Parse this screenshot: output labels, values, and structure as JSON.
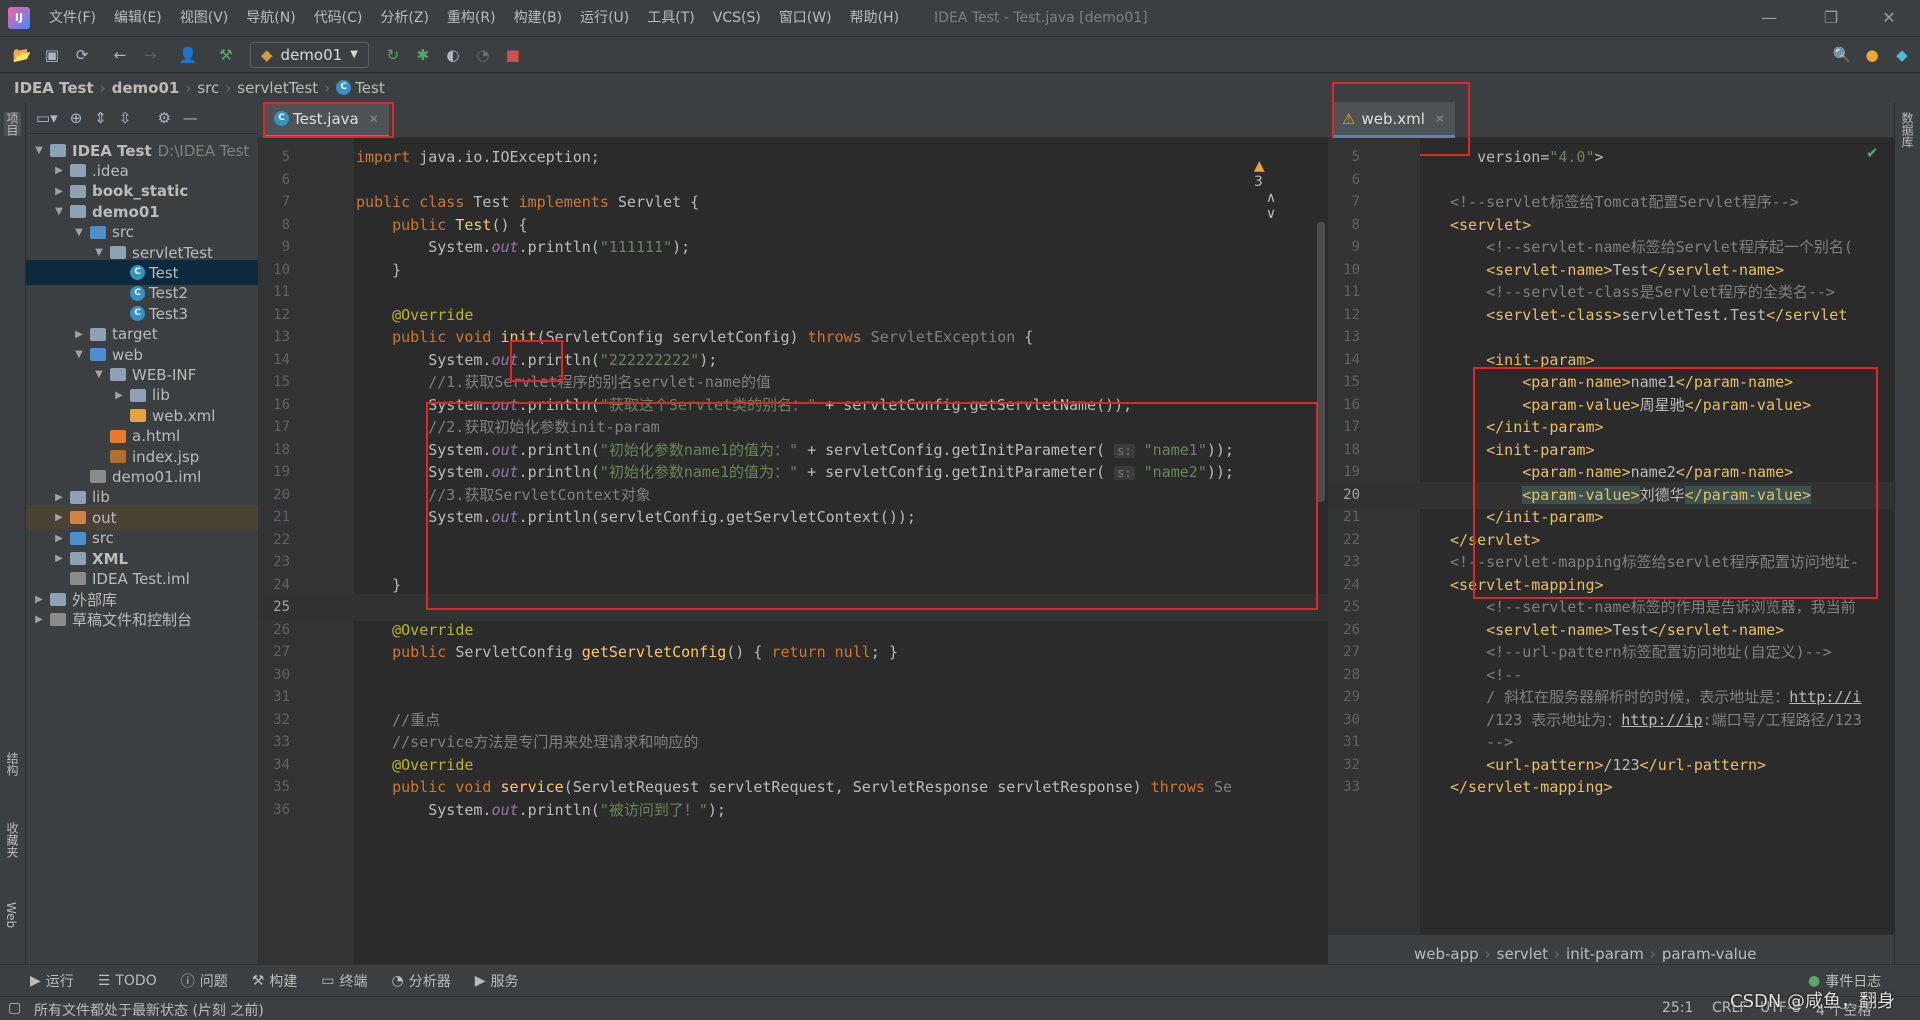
{
  "menubar": {
    "items": [
      "文件(F)",
      "编辑(E)",
      "视图(V)",
      "导航(N)",
      "代码(C)",
      "分析(Z)",
      "重构(R)",
      "构建(B)",
      "运行(U)",
      "工具(T)",
      "VCS(S)",
      "窗口(W)",
      "帮助(H)"
    ],
    "title": "IDEA Test - Test.java [demo01]"
  },
  "toolbar": {
    "run_config": "demo01"
  },
  "breadcrumb": [
    "IDEA Test",
    "demo01",
    "src",
    "servletTest",
    "Test"
  ],
  "side": {
    "left_top": "项目",
    "left_structure": "结构",
    "left_fav": "收藏夹",
    "left_web": "Web",
    "right_db": "数据库"
  },
  "tree": [
    {
      "label": "IDEA Test",
      "extra": "D:\\IDEA Test",
      "depth": 0,
      "arrow": "▼",
      "icon": "folder",
      "bold": true
    },
    {
      "label": ".idea",
      "depth": 1,
      "arrow": "▶",
      "icon": "folder"
    },
    {
      "label": "book_static",
      "depth": 1,
      "arrow": "▶",
      "icon": "folder",
      "bold": true
    },
    {
      "label": "demo01",
      "depth": 1,
      "arrow": "▼",
      "icon": "folder",
      "bold": true
    },
    {
      "label": "src",
      "depth": 2,
      "arrow": "▼",
      "icon": "folder src"
    },
    {
      "label": "servletTest",
      "depth": 3,
      "arrow": "▼",
      "icon": "folder"
    },
    {
      "label": "Test",
      "depth": 4,
      "arrow": "",
      "icon": "class",
      "selected": true
    },
    {
      "label": "Test2",
      "depth": 4,
      "arrow": "",
      "icon": "class"
    },
    {
      "label": "Test3",
      "depth": 4,
      "arrow": "",
      "icon": "class"
    },
    {
      "label": "target",
      "depth": 2,
      "arrow": "▶",
      "icon": "folder"
    },
    {
      "label": "web",
      "depth": 2,
      "arrow": "▼",
      "icon": "folder web"
    },
    {
      "label": "WEB-INF",
      "depth": 3,
      "arrow": "▼",
      "icon": "folder"
    },
    {
      "label": "lib",
      "depth": 4,
      "arrow": "▶",
      "icon": "folder"
    },
    {
      "label": "web.xml",
      "depth": 4,
      "arrow": "",
      "icon": "file-xml"
    },
    {
      "label": "a.html",
      "depth": 3,
      "arrow": "",
      "icon": "file-html"
    },
    {
      "label": "index.jsp",
      "depth": 3,
      "arrow": "",
      "icon": "file-jsp"
    },
    {
      "label": "demo01.iml",
      "depth": 2,
      "arrow": "",
      "icon": "file-iml"
    },
    {
      "label": "lib",
      "depth": 1,
      "arrow": "▶",
      "icon": "folder"
    },
    {
      "label": "out",
      "depth": 1,
      "arrow": "▶",
      "icon": "folder out",
      "out": true
    },
    {
      "label": "src",
      "depth": 1,
      "arrow": "▶",
      "icon": "folder src"
    },
    {
      "label": "XML",
      "depth": 1,
      "arrow": "▶",
      "icon": "folder",
      "bold": true
    },
    {
      "label": "IDEA Test.iml",
      "depth": 1,
      "arrow": "",
      "icon": "file-iml"
    },
    {
      "label": "外部库",
      "depth": 0,
      "arrow": "▶",
      "icon": "folder lib"
    },
    {
      "label": "草稿文件和控制台",
      "depth": 0,
      "arrow": "▶",
      "icon": "file-iml"
    }
  ],
  "left_editor": {
    "tab": "Test.java",
    "warnings": "3",
    "lines": [
      {
        "n": "5",
        "h": "<span class=\"kw\">import</span> java.io.IOException;"
      },
      {
        "n": "6",
        "h": ""
      },
      {
        "n": "7",
        "h": "<span class=\"kw\">public class</span> Test <span class=\"kw\">implements</span> Servlet {"
      },
      {
        "n": "8",
        "h": "    <span class=\"kw\">public</span> <span class=\"fn\">Test</span>() {"
      },
      {
        "n": "9",
        "h": "        System.<span class=\"fld\">out</span>.println(<span class=\"str\">\"111111\"</span>);"
      },
      {
        "n": "10",
        "h": "    }"
      },
      {
        "n": "11",
        "h": ""
      },
      {
        "n": "12",
        "h": "    <span class=\"ann\">@Override</span>"
      },
      {
        "n": "13",
        "h": "    <span class=\"kw\">public void</span> <span class=\"fn\">init</span>(ServletConfig servletConfig) <span class=\"kw\">throws</span> <span class=\"cmt\">ServletException</span> {"
      },
      {
        "n": "14",
        "h": "        System.<span class=\"fld\">out</span>.println(<span class=\"str\">\"222222222\"</span>);"
      },
      {
        "n": "15",
        "h": "        <span class=\"cmt\">//1.获取Servlet程序的别名servlet-name的值</span>"
      },
      {
        "n": "16",
        "h": "        System.<span class=\"fld\">out</span>.println(<span class=\"str\">\"获取这个Servlet类的别名：\"</span> + servletConfig.getServletName());"
      },
      {
        "n": "17",
        "h": "        <span class=\"cmt\">//2.获取初始化参数init-param</span>"
      },
      {
        "n": "18",
        "h": "        System.<span class=\"fld\">out</span>.println(<span class=\"str\">\"初始化参数name1的值为：\"</span> + servletConfig.getInitParameter( <span class=\"hint\">s:</span> <span class=\"str\">\"name1\"</span>));"
      },
      {
        "n": "19",
        "h": "        System.<span class=\"fld\">out</span>.println(<span class=\"str\">\"初始化参数name1的值为：\"</span> + servletConfig.getInitParameter( <span class=\"hint\">s:</span> <span class=\"str\">\"name2\"</span>));"
      },
      {
        "n": "20",
        "h": "        <span class=\"cmt\">//3.获取ServletContext对象</span>"
      },
      {
        "n": "21",
        "h": "        System.<span class=\"fld\">out</span>.println(servletConfig.getServletContext());"
      },
      {
        "n": "22",
        "h": ""
      },
      {
        "n": "23",
        "h": ""
      },
      {
        "n": "24",
        "h": "    }"
      },
      {
        "n": "25",
        "h": "",
        "cur": true
      },
      {
        "n": "26",
        "h": "    <span class=\"ann\">@Override</span>"
      },
      {
        "n": "27",
        "h": "    <span class=\"kw\">public</span> ServletConfig <span class=\"fn\">getServletConfig</span>() { <span class=\"kw\">return null</span>; }"
      },
      {
        "n": "30",
        "h": ""
      },
      {
        "n": "31",
        "h": ""
      },
      {
        "n": "32",
        "h": "    <span class=\"cmt\">//重点</span>"
      },
      {
        "n": "33",
        "h": "    <span class=\"cmt\">//service方法是专门用来处理请求和响应的</span>"
      },
      {
        "n": "34",
        "h": "    <span class=\"ann\">@Override</span>"
      },
      {
        "n": "35",
        "h": "    <span class=\"kw\">public void</span> <span class=\"fn\">service</span>(ServletRequest servletRequest, ServletResponse servletResponse) <span class=\"kw\">throws</span> <span class=\"cmt\">Se</span>"
      },
      {
        "n": "36",
        "h": "        System.<span class=\"fld\">out</span>.println(<span class=\"str\">\"被访问到了！\"</span>);"
      }
    ]
  },
  "right_editor": {
    "tab": "web.xml",
    "lines": [
      {
        "n": "5",
        "h": "   <span class=\"attr\">version</span>=<span class=\"str\">\"4.0\"</span>&gt;"
      },
      {
        "n": "6",
        "h": ""
      },
      {
        "n": "7",
        "h": "<span class=\"cmt\">&lt;!--servlet标签给Tomcat配置Servlet程序--&gt;</span>"
      },
      {
        "n": "8",
        "h": "<span class=\"tag\">&lt;servlet&gt;</span>"
      },
      {
        "n": "9",
        "h": "    <span class=\"cmt\">&lt;!--servlet-name标签给Servlet程序起一个别名(</span>"
      },
      {
        "n": "10",
        "h": "    <span class=\"tag\">&lt;servlet-name&gt;</span>Test<span class=\"tag\">&lt;/servlet-name&gt;</span>"
      },
      {
        "n": "11",
        "h": "    <span class=\"cmt\">&lt;!--servlet-class是Servlet程序的全类名--&gt;</span>"
      },
      {
        "n": "12",
        "h": "    <span class=\"tag\">&lt;servlet-class&gt;</span>servletTest.Test<span class=\"tag\">&lt;/servlet</span>"
      },
      {
        "n": "13",
        "h": ""
      },
      {
        "n": "14",
        "h": "    <span class=\"tag\">&lt;init-param&gt;</span>"
      },
      {
        "n": "15",
        "h": "        <span class=\"tag\">&lt;param-name&gt;</span>name1<span class=\"tag\">&lt;/param-name&gt;</span>"
      },
      {
        "n": "16",
        "h": "        <span class=\"tag\">&lt;param-value&gt;</span>周星驰<span class=\"tag\">&lt;/param-value&gt;</span>"
      },
      {
        "n": "17",
        "h": "    <span class=\"tag\">&lt;/init-param&gt;</span>"
      },
      {
        "n": "18",
        "h": "    <span class=\"tag\">&lt;init-param&gt;</span>"
      },
      {
        "n": "19",
        "h": "        <span class=\"tag\">&lt;param-name&gt;</span>name2<span class=\"tag\">&lt;/param-name&gt;</span>"
      },
      {
        "n": "20",
        "h": "        <span class=\"tag\" style=\"background:#3b514d\">&lt;param-value&gt;</span>刘德华<span class=\"tag\" style=\"background:#3b514d\">&lt;/param-value&gt;</span>",
        "cur": true
      },
      {
        "n": "21",
        "h": "    <span class=\"tag\">&lt;/init-param&gt;</span>"
      },
      {
        "n": "22",
        "h": "<span class=\"tag\">&lt;/servlet&gt;</span>"
      },
      {
        "n": "23",
        "h": "<span class=\"cmt\">&lt;!--servlet-mapping标签给servlet程序配置访问地址-</span>"
      },
      {
        "n": "24",
        "h": "<span class=\"tag\">&lt;servlet-mapping&gt;</span>"
      },
      {
        "n": "25",
        "h": "    <span class=\"cmt\">&lt;!--servlet-name标签的作用是告诉浏览器，我当前</span>"
      },
      {
        "n": "26",
        "h": "    <span class=\"tag\">&lt;servlet-name&gt;</span>Test<span class=\"tag\">&lt;/servlet-name&gt;</span>"
      },
      {
        "n": "27",
        "h": "    <span class=\"cmt\">&lt;!--url-pattern标签配置访问地址(自定义)--&gt;</span>"
      },
      {
        "n": "28",
        "h": "    <span class=\"cmt\">&lt;!--</span>"
      },
      {
        "n": "29",
        "h": "    <span class=\"cmt\">/ 斜杠在服务器解析时的时候，表示地址是：</span><span class=\"url\">http://i</span>"
      },
      {
        "n": "30",
        "h": "    <span class=\"cmt\">/123 表示地址为：</span><span class=\"url\">http://ip</span><span class=\"cmt\">:端口号/工程路径/123</span>"
      },
      {
        "n": "31",
        "h": "    <span class=\"cmt\">--&gt;</span>"
      },
      {
        "n": "32",
        "h": "    <span class=\"tag\">&lt;url-pattern&gt;</span>/123<span class=\"tag\">&lt;/url-pattern&gt;</span>"
      },
      {
        "n": "33",
        "h": "<span class=\"tag\">&lt;/servlet-mapping&gt;</span>"
      }
    ],
    "footer": [
      "web-app",
      "servlet",
      "init-param",
      "param-value"
    ]
  },
  "bottom": {
    "tabs": [
      "运行",
      "TODO",
      "问题",
      "构建",
      "终端",
      "分析器",
      "服务"
    ],
    "event_log": "事件日志"
  },
  "status": {
    "message": "所有文件都处于最新状态 (片刻 之前)",
    "pos": "25:1",
    "crlf": "CRLF",
    "enc": "UTF-8",
    "spaces": "4 个空格",
    "watermark": "CSDN @咸鱼，翻身"
  }
}
